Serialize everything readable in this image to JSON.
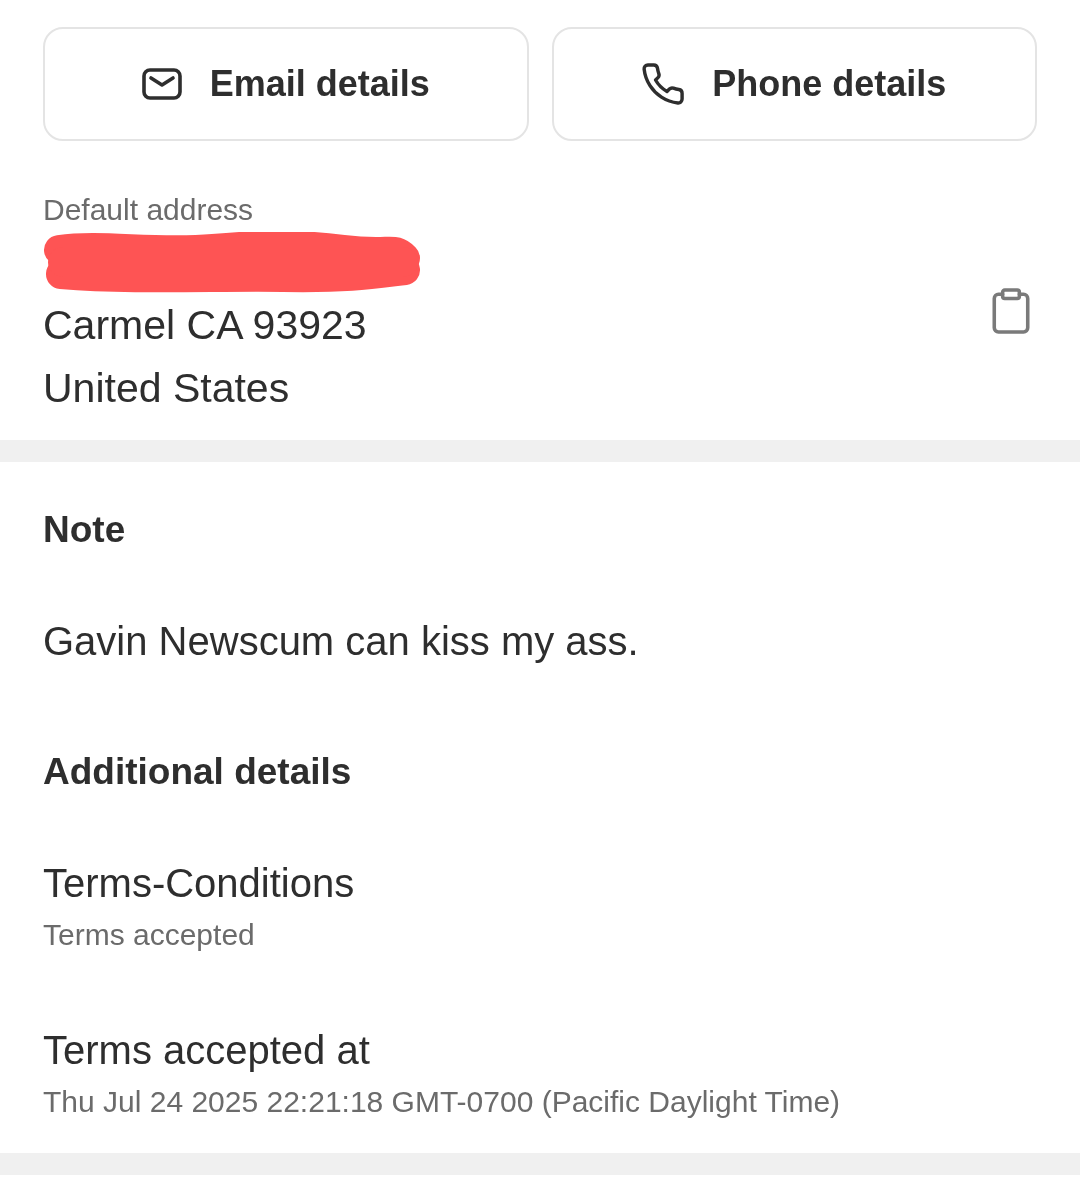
{
  "contact_buttons": [
    {
      "kind": "email",
      "label": "Email details"
    },
    {
      "kind": "phone",
      "label": "Phone details"
    }
  ],
  "default_address": {
    "label": "Default address",
    "lines": [
      {
        "kind": "redacted"
      },
      {
        "kind": "text",
        "text": "Carmel CA 93923"
      },
      {
        "kind": "text",
        "text": "United States"
      }
    ]
  },
  "note": {
    "title": "Note",
    "text": "Gavin Newscum can kiss my ass."
  },
  "additional_details": {
    "title": "Additional details",
    "items": [
      {
        "name": "Terms-Conditions",
        "value": "Terms accepted"
      },
      {
        "name": "Terms accepted at",
        "value": "Thu Jul 24 2025 22:21:18 GMT-0700 (Pacific Daylight Time)"
      }
    ]
  }
}
